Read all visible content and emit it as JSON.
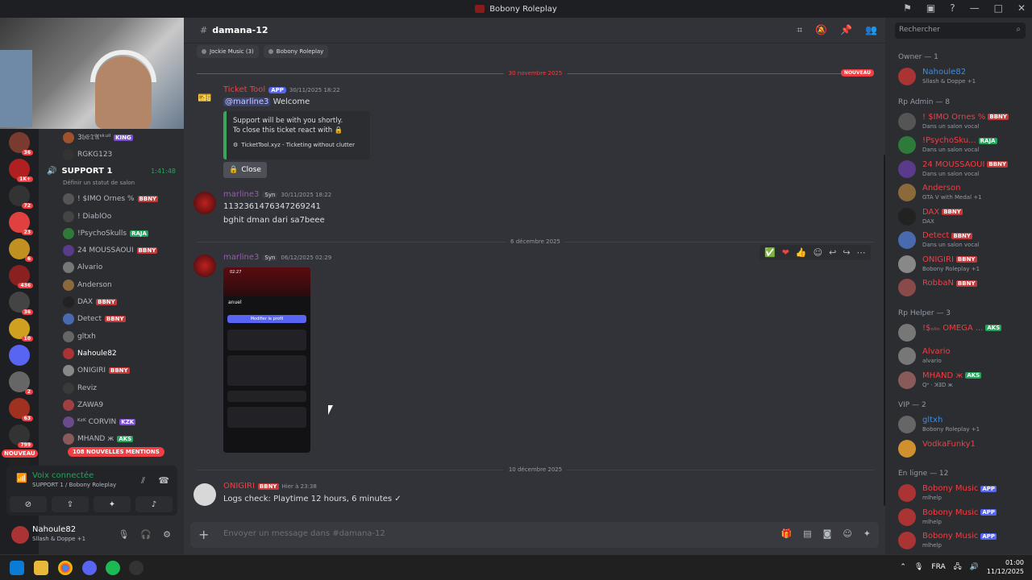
{
  "window": {
    "title": "Bobony Roleplay"
  },
  "servers": [
    {
      "badge": "36",
      "color": "#7a3b2f"
    },
    {
      "badge": "1K+",
      "color": "#b02020"
    },
    {
      "badge": "72",
      "color": "#333"
    },
    {
      "badge": "23",
      "color": "#e04040"
    },
    {
      "badge": "6",
      "color": "#c09020"
    },
    {
      "badge": "436",
      "color": "#8a2020"
    },
    {
      "badge": "36",
      "color": "#444"
    },
    {
      "badge": "10",
      "color": "#d0a020"
    },
    {
      "badge": "",
      "color": "#5865f2"
    },
    {
      "badge": "2",
      "color": "#666"
    },
    {
      "badge": "63",
      "color": "#a03020"
    },
    {
      "badge": "799",
      "color": "#333"
    },
    {
      "badge": "",
      "color": "#222"
    }
  ],
  "channels": {
    "voice_users_top": [
      {
        "name": "3𝔥𝔈𝔗𝔄ˢᵏᵘˡˡ",
        "tag": "KING",
        "tagcolor": "#7a4fd1",
        "color": "#b5bac1",
        "av": "#a0522d"
      },
      {
        "name": "RGKG123",
        "tag": "",
        "tagcolor": "",
        "color": "#b5bac1",
        "av": "#333"
      }
    ],
    "voice_channel": {
      "name": "SUPPORT 1",
      "time": "1:41:48",
      "status": "Définir un statut de salon"
    },
    "voice_users": [
      {
        "name": "! $IMO Ornes %",
        "tag": "BBNY",
        "tagcolor": "#c23a3a",
        "color": "#b5bac1",
        "av": "#555"
      },
      {
        "name": "! DiablOo",
        "tag": "",
        "tagcolor": "",
        "color": "#b5bac1",
        "av": "#444"
      },
      {
        "name": "!PsychoSkulls",
        "tag": "RAJA",
        "tagcolor": "#23a55a",
        "color": "#b5bac1",
        "av": "#2d7a3a"
      },
      {
        "name": "24 MOUSSAOUI",
        "tag": "BBNY",
        "tagcolor": "#c23a3a",
        "color": "#b5bac1",
        "av": "#5a3a8a"
      },
      {
        "name": "Alvario",
        "tag": "",
        "tagcolor": "",
        "color": "#b5bac1",
        "av": "#777"
      },
      {
        "name": "Anderson",
        "tag": "",
        "tagcolor": "",
        "color": "#b5bac1",
        "av": "#8a6a3a"
      },
      {
        "name": "DAX",
        "tag": "BBNY",
        "tagcolor": "#c23a3a",
        "color": "#b5bac1",
        "av": "#222"
      },
      {
        "name": "Detect",
        "tag": "BBNY",
        "tagcolor": "#c23a3a",
        "color": "#b5bac1",
        "av": "#4a6ab0"
      },
      {
        "name": "gltxh",
        "tag": "",
        "tagcolor": "",
        "color": "#b5bac1",
        "av": "#666"
      },
      {
        "name": "Nahoule82",
        "tag": "",
        "tagcolor": "",
        "color": "#ffffff",
        "av": "#a33"
      },
      {
        "name": "ONIGIRI",
        "tag": "BBNY",
        "tagcolor": "#c23a3a",
        "color": "#b5bac1",
        "av": "#888"
      },
      {
        "name": "Reviz",
        "tag": "",
        "tagcolor": "",
        "color": "#b5bac1",
        "av": "#3a3a3a"
      },
      {
        "name": "ZAWA9",
        "tag": "",
        "tagcolor": "",
        "color": "#b5bac1",
        "av": "#a04040"
      },
      {
        "name": "ᴷᶻᴷ CORVIN",
        "tag": "KZK",
        "tagcolor": "#7a4fd1",
        "color": "#b5bac1",
        "av": "#6a4a8a"
      },
      {
        "name": "MHAND ж",
        "tag": "AKS",
        "tagcolor": "#23a55a",
        "color": "#b5bac1",
        "av": "#8a5a5a"
      }
    ],
    "mentions": "108 NOUVELLES MENTIONS",
    "nouveau": "NOUVEAU",
    "voice_panel": {
      "title": "Voix connectée",
      "sub": "SUPPORT 1 / Bobony Roleplay"
    },
    "user": {
      "name": "Nahoule82",
      "status": "Sllash & Doppe +1"
    }
  },
  "main": {
    "channel": "damana-12",
    "chips": [
      "Jockie Music (3)",
      "Bobony Roleplay"
    ],
    "dividers": [
      "30 novembre 2025",
      "6 décembre 2025",
      "10 décembre 2025"
    ],
    "nouveau": "NOUVEAU",
    "messages": [
      {
        "author": "Ticket Tool",
        "badge": "APP",
        "time": "30/11/2025 18:22",
        "mention": "@marline3",
        "text": "Welcome",
        "embed": {
          "line1": "Support will be with you shortly.",
          "line2": "To close this ticket react with 🔒",
          "footer": "TicketTool.xyz - Ticketing without clutter"
        },
        "button": "Close"
      },
      {
        "author": "marline3",
        "badge": "Syn",
        "time": "30/11/2025 18:22",
        "lines": [
          "1132361476347269241",
          "bghit dman dari sa7beee"
        ]
      },
      {
        "author": "marline3",
        "badge": "Syn",
        "time": "06/12/2025 02:29",
        "phone": {
          "time": "02:27",
          "name": "anuel",
          "button": "Modifier le profil"
        }
      },
      {
        "author": "ONIGIRI",
        "badge": "BBNY",
        "time": "Hier à 23:38",
        "text": "Logs check: Playtime 12 hours, 6 minutes ✓"
      }
    ],
    "composer_placeholder": "Envoyer un message dans #damana-12"
  },
  "members": {
    "search": "Rechercher",
    "groups": [
      {
        "title": "Owner — 1",
        "items": [
          {
            "name": "Nahoule82",
            "sub": "Sllash & Doppe +1",
            "color": "#3a8ee6",
            "tag": "",
            "tagcolor": "",
            "av": "#a33"
          }
        ]
      },
      {
        "title": "Rp Admin — 8",
        "items": [
          {
            "name": "! $IMO Ornes %",
            "sub": "Dans un salon vocal",
            "color": "#f23f43",
            "tag": "BBNY",
            "tagcolor": "#c23a3a",
            "av": "#555"
          },
          {
            "name": "!PsychoSku...",
            "sub": "Dans un salon vocal",
            "color": "#f23f43",
            "tag": "RAJA",
            "tagcolor": "#23a55a",
            "av": "#2d7a3a"
          },
          {
            "name": "24 MOUSSAOUI",
            "sub": "Dans un salon vocal",
            "color": "#f23f43",
            "tag": "BBNY",
            "tagcolor": "#c23a3a",
            "av": "#5a3a8a"
          },
          {
            "name": "Anderson",
            "sub": "GTA V with Medal +1",
            "color": "#f23f43",
            "tag": "",
            "tagcolor": "",
            "av": "#8a6a3a"
          },
          {
            "name": "DAX",
            "sub": "DAX",
            "color": "#f23f43",
            "tag": "BBNY",
            "tagcolor": "#c23a3a",
            "av": "#222"
          },
          {
            "name": "Detect",
            "sub": "Dans un salon vocal",
            "color": "#f23f43",
            "tag": "BBNY",
            "tagcolor": "#c23a3a",
            "av": "#4a6ab0"
          },
          {
            "name": "ONIGIRI",
            "sub": "Bobony Roleplay +1",
            "color": "#f23f43",
            "tag": "BBNY",
            "tagcolor": "#c23a3a",
            "av": "#888"
          },
          {
            "name": "RobbaN",
            "sub": "",
            "color": "#f23f43",
            "tag": "BBNY",
            "tagcolor": "#c23a3a",
            "av": "#8a4a4a"
          }
        ]
      },
      {
        "title": "Rp Helper — 3",
        "items": [
          {
            "name": "!$ₒₗᵢₒ OMEGA ...",
            "sub": "",
            "color": "#f23f43",
            "tag": "AKS",
            "tagcolor": "#23a55a",
            "av": "#777"
          },
          {
            "name": "Alvario",
            "sub": "alvario",
            "color": "#f23f43",
            "tag": "",
            "tagcolor": "",
            "av": "#777"
          },
          {
            "name": "MHAND ж",
            "sub": "Qᵃ · ꓘꓱꓓ ж",
            "color": "#f23f43",
            "tag": "AKS",
            "tagcolor": "#23a55a",
            "av": "#8a5a5a"
          }
        ]
      },
      {
        "title": "VIP — 2",
        "items": [
          {
            "name": "gltxh",
            "sub": "Bobony Roleplay +1",
            "color": "#3a8ee6",
            "tag": "",
            "tagcolor": "",
            "av": "#666"
          },
          {
            "name": "VodkaFunky1",
            "sub": "",
            "color": "#f23f43",
            "tag": "",
            "tagcolor": "",
            "av": "#d09030"
          }
        ]
      },
      {
        "title": "En ligne — 12",
        "items": [
          {
            "name": "Bobony Music",
            "sub": "mlhelp",
            "color": "#f23f43",
            "tag": "APP",
            "tagcolor": "#5865f2",
            "av": "#a33"
          },
          {
            "name": "Bobony Music",
            "sub": "mlhelp",
            "color": "#f23f43",
            "tag": "APP",
            "tagcolor": "#5865f2",
            "av": "#a33"
          },
          {
            "name": "Bobony Music",
            "sub": "mlhelp",
            "color": "#f23f43",
            "tag": "APP",
            "tagcolor": "#5865f2",
            "av": "#a33"
          }
        ]
      }
    ]
  },
  "taskbar": {
    "lang": "FRA",
    "time": "01:00",
    "date": "11/12/2025"
  }
}
